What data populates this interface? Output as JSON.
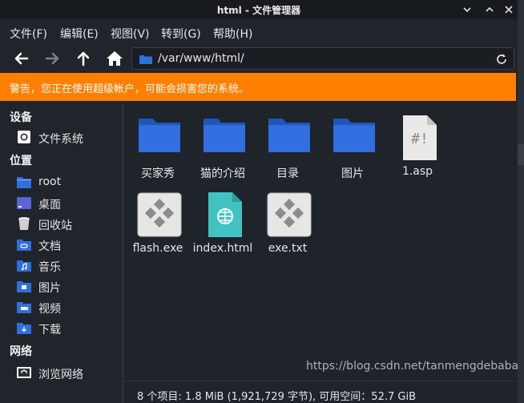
{
  "window": {
    "title": "html - 文件管理器"
  },
  "menu": [
    "文件(F)",
    "编辑(E)",
    "视图(V)",
    "转到(G)",
    "帮助(H)"
  ],
  "location": {
    "path": "/var/www/html/"
  },
  "warning": "警告，您正在使用超级帐户，可能会损害您的系统。",
  "sidebar": {
    "devices_heading": "设备",
    "devices": [
      {
        "label": "文件系统",
        "icon": "drive-icon"
      }
    ],
    "places_heading": "位置",
    "places": [
      {
        "label": "root",
        "icon": "home-folder-icon"
      },
      {
        "label": "桌面",
        "icon": "desktop-icon"
      },
      {
        "label": "回收站",
        "icon": "trash-icon"
      },
      {
        "label": "文档",
        "icon": "documents-icon"
      },
      {
        "label": "音乐",
        "icon": "music-icon"
      },
      {
        "label": "图片",
        "icon": "pictures-icon"
      },
      {
        "label": "视频",
        "icon": "videos-icon"
      },
      {
        "label": "下载",
        "icon": "downloads-icon"
      }
    ],
    "network_heading": "网络",
    "network": [
      {
        "label": "浏览网络",
        "icon": "network-icon"
      }
    ]
  },
  "files": [
    {
      "name": "买家秀",
      "icon": "folder-icon"
    },
    {
      "name": "猫的介绍",
      "icon": "folder-icon"
    },
    {
      "name": "目录",
      "icon": "folder-icon"
    },
    {
      "name": "图片",
      "icon": "folder-icon"
    },
    {
      "name": "1.asp",
      "icon": "script-file-icon"
    },
    {
      "name": "flash.exe",
      "icon": "executable-icon"
    },
    {
      "name": "index.html",
      "icon": "html-file-icon"
    },
    {
      "name": "exe.txt",
      "icon": "executable-icon"
    }
  ],
  "status": "8 个项目: 1.8 MiB (1,921,729 字节), 可用空间：52.7 GiB",
  "watermark": "https://blog.csdn.net/tanmengdebaba",
  "colors": {
    "warning": "#ff7f00",
    "folder": "#2f6fe0",
    "background": "#1f232a"
  }
}
